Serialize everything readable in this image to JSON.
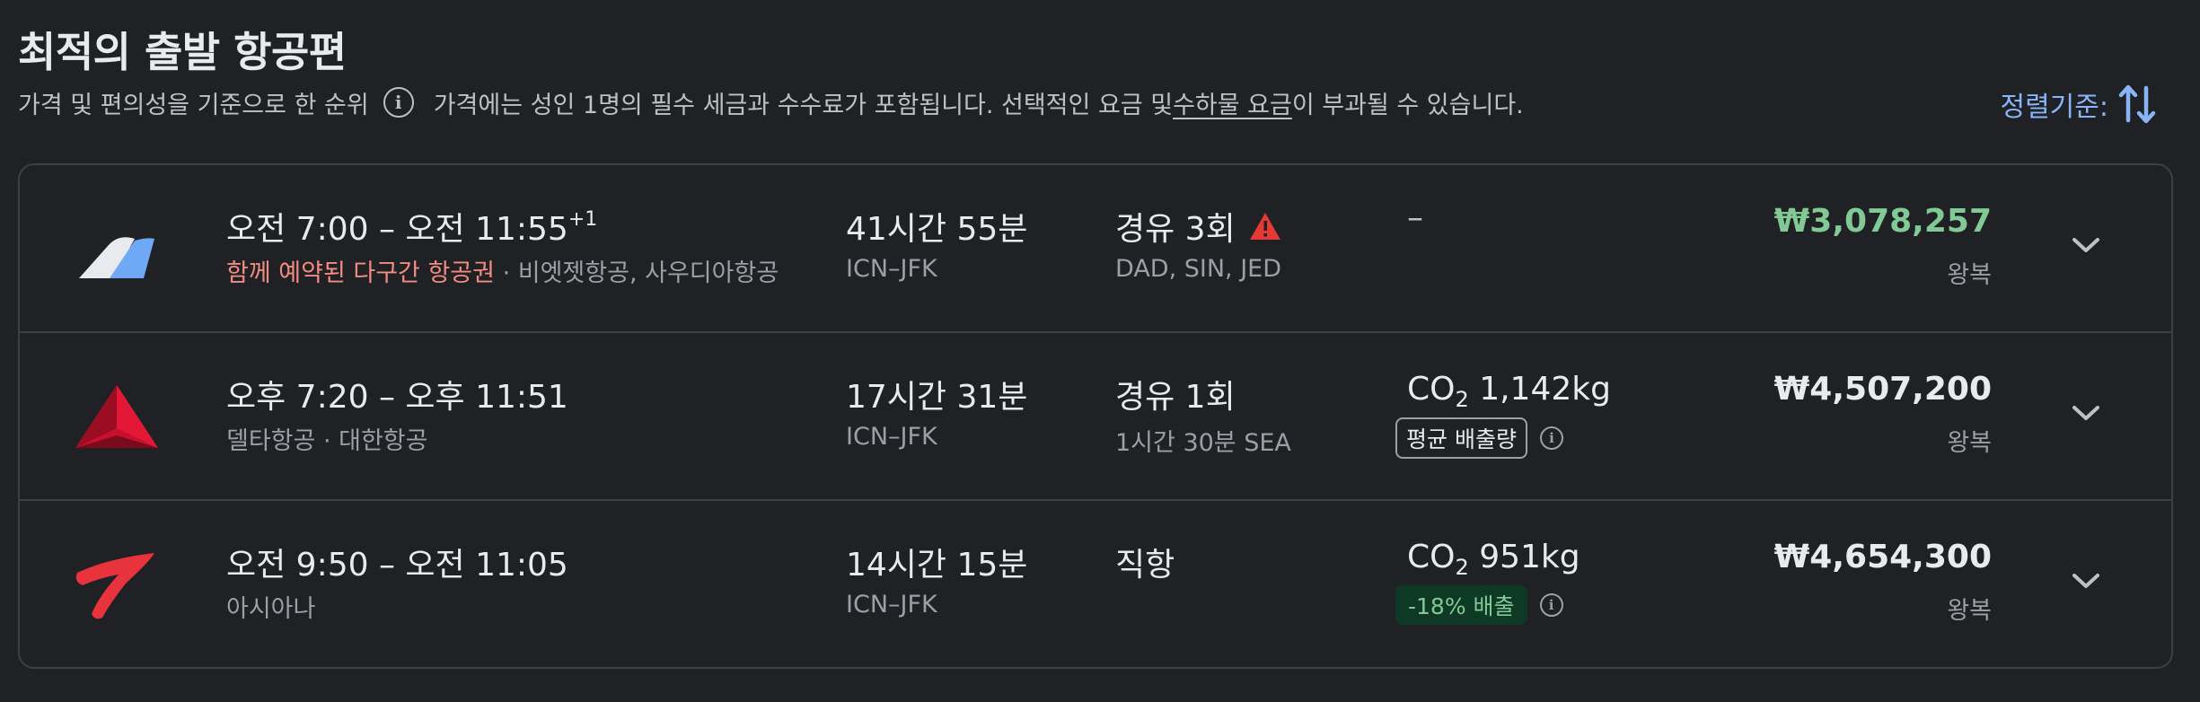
{
  "header": {
    "title": "최적의 출발 항공편",
    "ranking_text": "가격 및 편의성을 기준으로 한 순위",
    "info_icon_glyph": "i",
    "price_note_before": "가격에는 성인 1명의 필수 세금과 수수료가 포함됩니다. 선택적인 요금 및 ",
    "price_note_link": "수하물 요금",
    "price_note_after": "이 부과될 수 있습니다.",
    "sort_label": "정렬기준:",
    "sort_icon": "swap-vert-icon"
  },
  "flights": [
    {
      "logo": "vietjet-logo",
      "times_main": "오전 7:00 – 오전 11:55",
      "times_offset": "+1",
      "airline_warning": "함께 예약된 다구간 항공권",
      "airline_sep": " · ",
      "airlines": "비엣젯항공, 사우디아항공",
      "duration": "41시간 55분",
      "route": "ICN–JFK",
      "stops": "경유 3회",
      "stops_warning_icon": "warning-icon",
      "stop_detail": "DAD, SIN, JED",
      "emissions": "–",
      "price": "₩3,078,257",
      "price_color": "#81c995",
      "trip_type": "왕복"
    },
    {
      "logo": "delta-logo",
      "times_main": "오후 7:20 – 오후 11:51",
      "airlines": "델타항공 · 대한항공",
      "duration": "17시간 31분",
      "route": "ICN–JFK",
      "stops": "경유 1회",
      "stop_detail": "1시간 30분 SEA",
      "co2_prefix": "CO",
      "co2_sub": "2",
      "co2_value": " 1,142kg",
      "emission_badge": "평균 배출량",
      "price": "₩4,507,200",
      "trip_type": "왕복"
    },
    {
      "logo": "asiana-logo",
      "times_main": "오전 9:50 – 오전 11:05",
      "airlines": "아시아나",
      "duration": "14시간 15분",
      "route": "ICN–JFK",
      "stops": "직항",
      "co2_prefix": "CO",
      "co2_sub": "2",
      "co2_value": " 951kg",
      "emission_badge": "-18% 배출",
      "price": "₩4,654,300",
      "trip_type": "왕복"
    }
  ],
  "colors": {
    "background": "#202124",
    "accent_blue": "#8ab4f8",
    "warning_red": "#f28b82",
    "eco_green": "#81c995"
  }
}
